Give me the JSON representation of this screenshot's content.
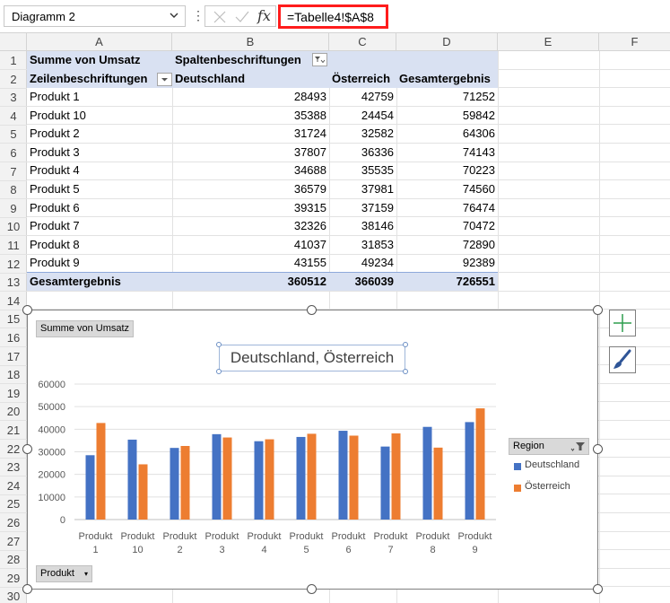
{
  "formula_bar": {
    "name_box": "Diagramm 2",
    "formula": "=Tabelle4!$A$8",
    "fx_label": "fx",
    "more_label": "⋮"
  },
  "columns": [
    "A",
    "B",
    "C",
    "D",
    "E",
    "F"
  ],
  "rows": [
    "1",
    "2",
    "3",
    "4",
    "5",
    "6",
    "7",
    "8",
    "9",
    "10",
    "11",
    "12",
    "13",
    "14",
    "15",
    "16",
    "17",
    "18",
    "19",
    "20",
    "21",
    "22",
    "23",
    "24",
    "25",
    "26",
    "27",
    "28",
    "29",
    "30"
  ],
  "pivot": {
    "a1": "Summe von Umsatz",
    "b1": "Spaltenbeschriftungen",
    "a2": "Zeilenbeschriftungen",
    "b2": "Deutschland",
    "c2": "Österreich",
    "d2": "Gesamtergebnis",
    "rows": [
      {
        "label": "Produkt 1",
        "de": "28493",
        "at": "42759",
        "total": "71252"
      },
      {
        "label": "Produkt 10",
        "de": "35388",
        "at": "24454",
        "total": "59842"
      },
      {
        "label": "Produkt 2",
        "de": "31724",
        "at": "32582",
        "total": "64306"
      },
      {
        "label": "Produkt 3",
        "de": "37807",
        "at": "36336",
        "total": "74143"
      },
      {
        "label": "Produkt 4",
        "de": "34688",
        "at": "35535",
        "total": "70223"
      },
      {
        "label": "Produkt 5",
        "de": "36579",
        "at": "37981",
        "total": "74560"
      },
      {
        "label": "Produkt 6",
        "de": "39315",
        "at": "37159",
        "total": "76474"
      },
      {
        "label": "Produkt 7",
        "de": "32326",
        "at": "38146",
        "total": "70472"
      },
      {
        "label": "Produkt 8",
        "de": "41037",
        "at": "31853",
        "total": "72890"
      },
      {
        "label": "Produkt 9",
        "de": "43155",
        "at": "49234",
        "total": "92389"
      }
    ],
    "total": {
      "label": "Gesamtergebnis",
      "de": "360512",
      "at": "366039",
      "total": "726551"
    }
  },
  "chart": {
    "value_field_button": "Summe von Umsatz",
    "axis_field_button": "Produkt",
    "legend_field_button": "Region"
  },
  "chart_data": {
    "type": "bar",
    "title": "Deutschland, Österreich",
    "categories": [
      "Produkt 1",
      "Produkt 10",
      "Produkt 2",
      "Produkt 3",
      "Produkt 4",
      "Produkt 5",
      "Produkt 6",
      "Produkt 7",
      "Produkt 8",
      "Produkt 9"
    ],
    "category_lines": [
      [
        "Produkt",
        "1"
      ],
      [
        "Produkt",
        "10"
      ],
      [
        "Produkt",
        "2"
      ],
      [
        "Produkt",
        "3"
      ],
      [
        "Produkt",
        "4"
      ],
      [
        "Produkt",
        "5"
      ],
      [
        "Produkt",
        "6"
      ],
      [
        "Produkt",
        "7"
      ],
      [
        "Produkt",
        "8"
      ],
      [
        "Produkt",
        "9"
      ]
    ],
    "series": [
      {
        "name": "Deutschland",
        "color": "#4472c4",
        "values": [
          28493,
          35388,
          31724,
          37807,
          34688,
          36579,
          39315,
          32326,
          41037,
          43155
        ]
      },
      {
        "name": "Österreich",
        "color": "#ed7d31",
        "values": [
          42759,
          24454,
          32582,
          36336,
          35535,
          37981,
          37159,
          38146,
          31853,
          49234
        ]
      }
    ],
    "ylim": [
      0,
      60000
    ],
    "yticks": [
      "0",
      "10000",
      "20000",
      "30000",
      "40000",
      "50000",
      "60000"
    ],
    "grid": true,
    "legend_position": "right"
  }
}
